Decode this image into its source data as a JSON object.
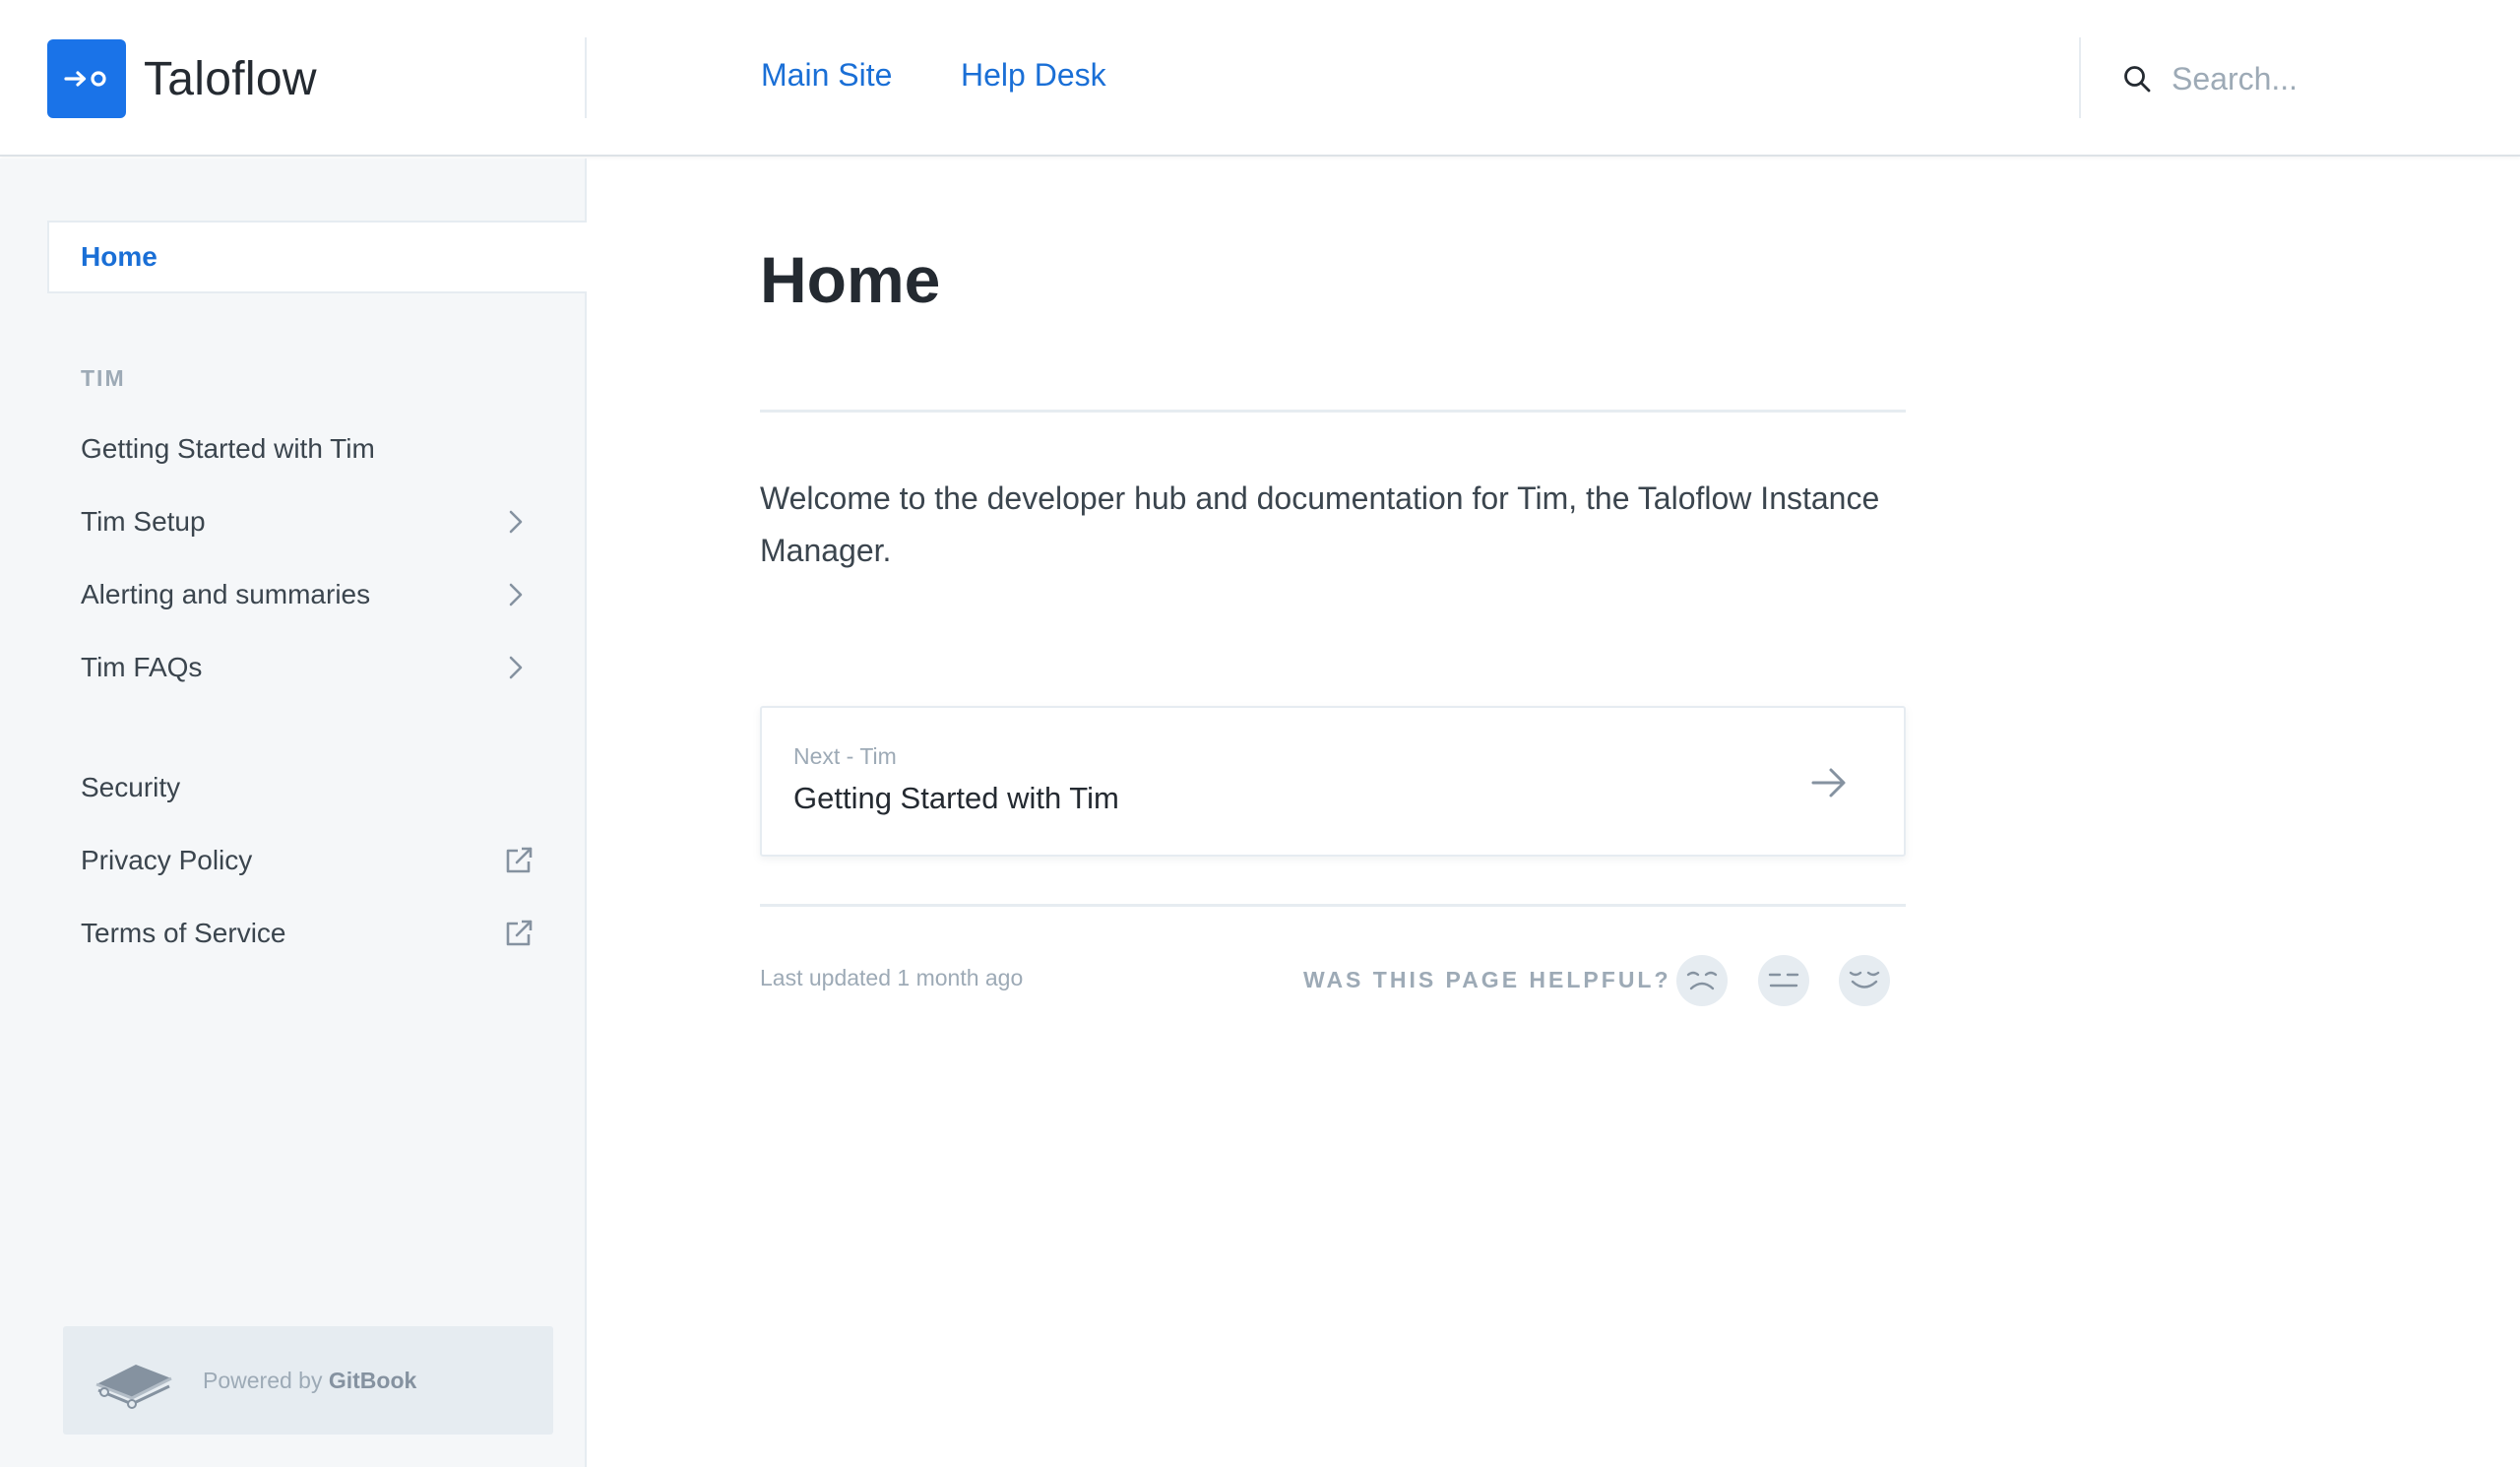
{
  "header": {
    "brand_name": "Taloflow",
    "links": [
      "Main Site",
      "Help Desk"
    ],
    "search_placeholder": "Search..."
  },
  "sidebar": {
    "home_label": "Home",
    "section_title": "TIM",
    "items": [
      {
        "label": "Getting Started with Tim",
        "icon": "none"
      },
      {
        "label": "Tim Setup",
        "icon": "chevron-right-icon"
      },
      {
        "label": "Alerting and summaries",
        "icon": "chevron-right-icon"
      },
      {
        "label": "Tim FAQs",
        "icon": "chevron-right-icon"
      }
    ],
    "footer_items": [
      {
        "label": "Security",
        "icon": "none"
      },
      {
        "label": "Privacy Policy",
        "icon": "external-link-icon"
      },
      {
        "label": "Terms of Service",
        "icon": "external-link-icon"
      }
    ],
    "powered_by": "Powered by",
    "powered_brand": "GitBook"
  },
  "main": {
    "title": "Home",
    "intro": "Welcome to the developer hub and documentation for Tim, the Taloflow Instance Manager.",
    "next": {
      "label": "Next - Tim",
      "title": "Getting Started with Tim"
    },
    "last_updated": "Last updated 1 month ago",
    "helpful_label": "WAS THIS PAGE HELPFUL?",
    "feedback_faces": [
      "sad-face-icon",
      "neutral-face-icon",
      "happy-face-icon"
    ]
  },
  "colors": {
    "accent": "#1a73e8",
    "link": "#1a6fd6",
    "text": "#242a31",
    "muted": "#9daab6",
    "sidebar_bg": "#f5f7f9",
    "border": "#e6ecf1"
  }
}
